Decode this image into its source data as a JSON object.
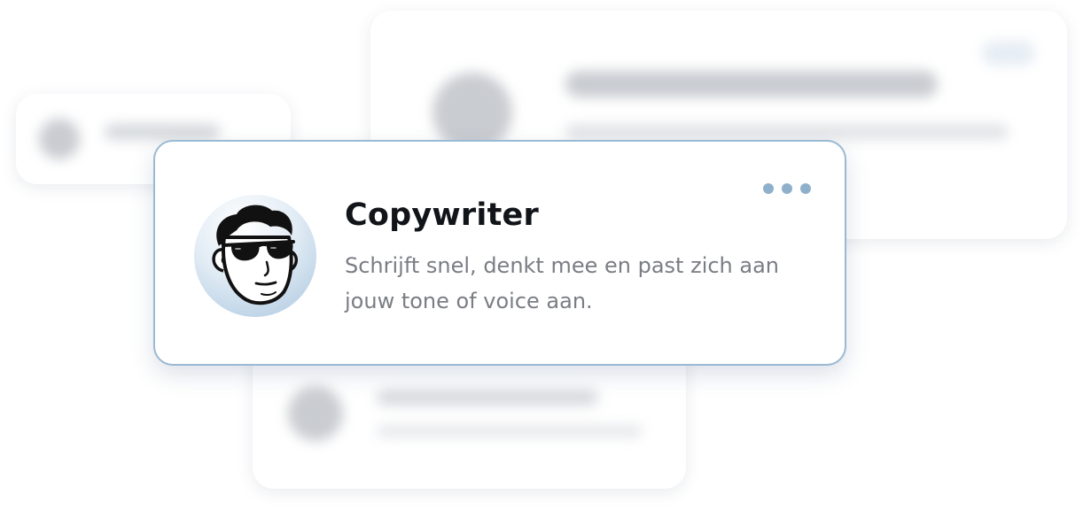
{
  "agent_card": {
    "title": "Copywriter",
    "description": "Schrijft snel, denkt mee en past zich aan jouw tone of voice aan.",
    "avatar_icon": "copywriter-avatar-sunglasses",
    "menu_icon": "more-horizontal-icon"
  },
  "colors": {
    "card_border": "#9ab9d2",
    "menu_dots": "#8fb0cb",
    "title_text": "#111418",
    "description_text": "#7a7d83",
    "avatar_gradient_end": "#a9c6df"
  }
}
